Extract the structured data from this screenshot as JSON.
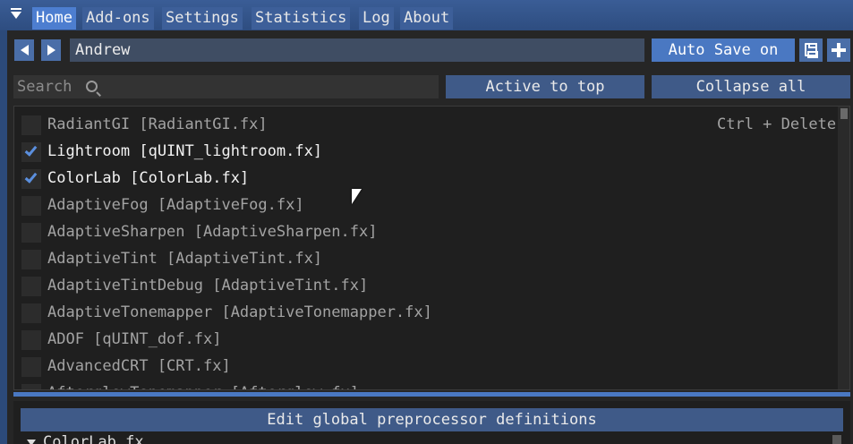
{
  "menu": {
    "tabs": [
      "Home",
      "Add-ons",
      "Settings",
      "Statistics",
      "Log",
      "About"
    ],
    "active_tab": "Home"
  },
  "preset": {
    "name": "Andrew",
    "auto_save_label": "Auto Save on"
  },
  "search": {
    "placeholder": "Search",
    "active_to_top_label": "Active to top",
    "collapse_all_label": "Collapse all"
  },
  "effects": [
    {
      "label": "RadiantGI [RadiantGI.fx]",
      "checked": false,
      "shortcut": "Ctrl + Delete"
    },
    {
      "label": "Lightroom [qUINT_lightroom.fx]",
      "checked": true
    },
    {
      "label": "ColorLab [ColorLab.fx]",
      "checked": true
    },
    {
      "label": "AdaptiveFog [AdaptiveFog.fx]",
      "checked": false
    },
    {
      "label": "AdaptiveSharpen [AdaptiveSharpen.fx]",
      "checked": false
    },
    {
      "label": "AdaptiveTint [AdaptiveTint.fx]",
      "checked": false
    },
    {
      "label": "AdaptiveTintDebug [AdaptiveTint.fx]",
      "checked": false
    },
    {
      "label": "AdaptiveTonemapper [AdaptiveTonemapper.fx]",
      "checked": false
    },
    {
      "label": "ADOF [qUINT_dof.fx]",
      "checked": false
    },
    {
      "label": "AdvancedCRT [CRT.fx]",
      "checked": false
    },
    {
      "label": "AfterglowTonemapper [Afterglow.fx]",
      "checked": false
    }
  ],
  "lower": {
    "edit_defs_label": "Edit global preprocessor definitions",
    "tree_node_label": "ColorLab.fx"
  },
  "colors": {
    "accent": "#4a78c2",
    "check": "#5b8fde",
    "titlebar": "#2e4d80"
  }
}
